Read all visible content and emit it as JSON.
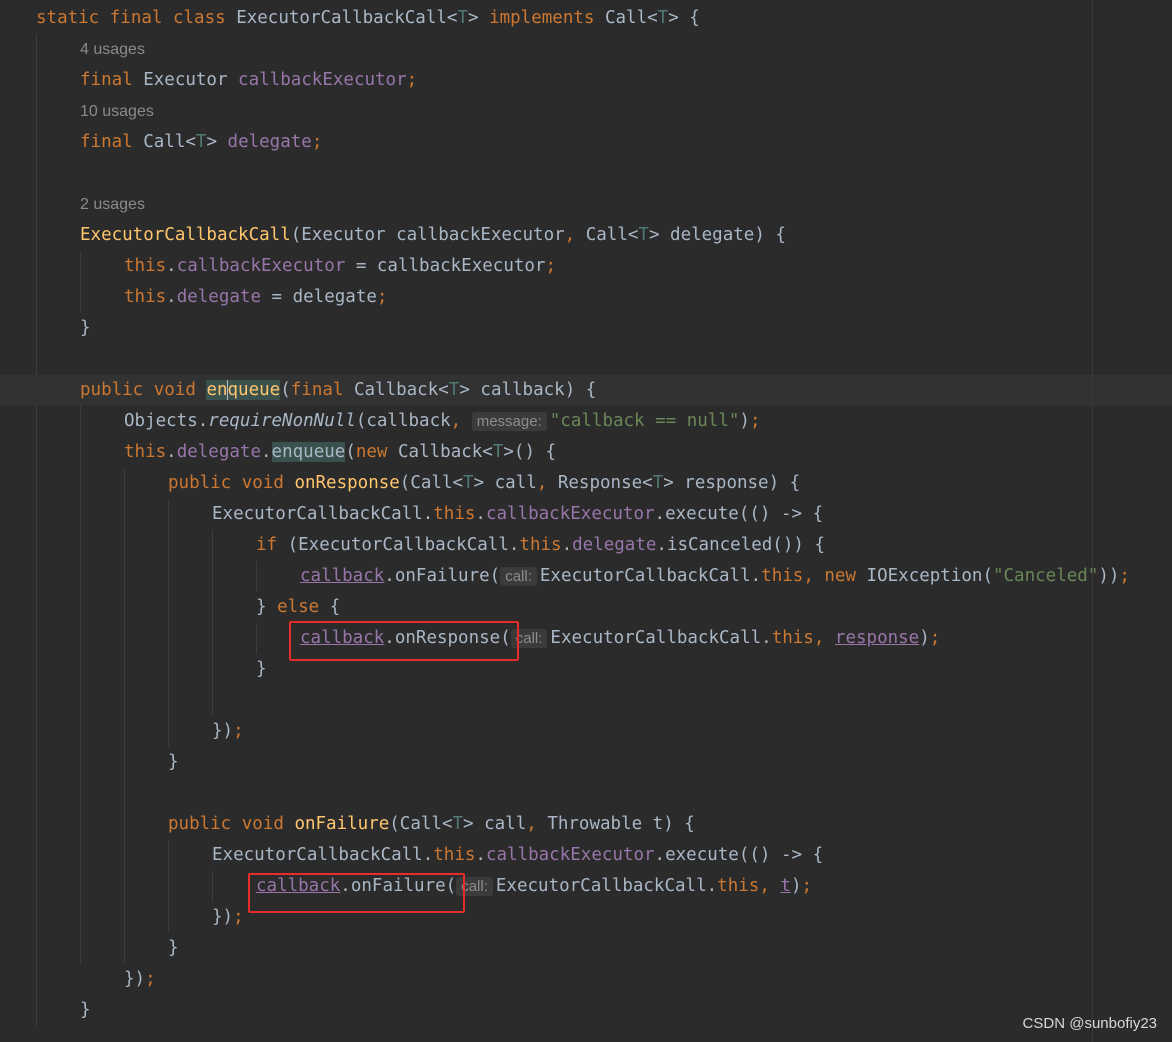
{
  "editor": {
    "lines": [
      {
        "tokens": [
          {
            "t": "static final class ",
            "c": "kw"
          },
          {
            "t": "ExecutorCallbackCall<"
          },
          {
            "t": "T",
            "c": "tp"
          },
          {
            "t": "> "
          },
          {
            "t": "implements ",
            "c": "kw"
          },
          {
            "t": "Call<"
          },
          {
            "t": "T",
            "c": "tp"
          },
          {
            "t": "> {"
          }
        ]
      },
      {
        "usage": "4 usages"
      },
      {
        "tokens": [
          {
            "t": "final ",
            "c": "kw"
          },
          {
            "t": "Executor "
          },
          {
            "t": "callbackExecutor",
            "c": "fld"
          },
          {
            "t": ";",
            "c": "kw"
          }
        ]
      },
      {
        "usage": "10 usages"
      },
      {
        "tokens": [
          {
            "t": "final ",
            "c": "kw"
          },
          {
            "t": "Call<"
          },
          {
            "t": "T",
            "c": "tp"
          },
          {
            "t": "> "
          },
          {
            "t": "delegate",
            "c": "fld"
          },
          {
            "t": ";",
            "c": "kw"
          }
        ]
      },
      {
        "tokens": []
      },
      {
        "usage": "2 usages"
      },
      {
        "tokens": [
          {
            "t": "ExecutorCallbackCall",
            "c": "fn"
          },
          {
            "t": "(Executor callbackExecutor"
          },
          {
            "t": ", ",
            "c": "kw"
          },
          {
            "t": "Call<"
          },
          {
            "t": "T",
            "c": "tp"
          },
          {
            "t": "> delegate) {"
          }
        ]
      },
      {
        "tokens": [
          {
            "t": "this",
            "c": "kw"
          },
          {
            "t": "."
          },
          {
            "t": "callbackExecutor",
            "c": "fld"
          },
          {
            "t": " = callbackExecutor"
          },
          {
            "t": ";",
            "c": "kw"
          }
        ]
      },
      {
        "tokens": [
          {
            "t": "this",
            "c": "kw"
          },
          {
            "t": "."
          },
          {
            "t": "delegate",
            "c": "fld"
          },
          {
            "t": " = delegate"
          },
          {
            "t": ";",
            "c": "kw"
          }
        ]
      },
      {
        "tokens": [
          {
            "t": "}"
          }
        ]
      },
      {
        "tokens": []
      },
      {
        "current": true,
        "tokens": [
          {
            "t": "public void ",
            "c": "kw"
          },
          {
            "t": "en",
            "c": "fn hl"
          },
          {
            "caret": true
          },
          {
            "t": "queue",
            "c": "fn hl"
          },
          {
            "t": "("
          },
          {
            "t": "final ",
            "c": "kw"
          },
          {
            "t": "Callback<"
          },
          {
            "t": "T",
            "c": "tp"
          },
          {
            "t": "> callback) {"
          }
        ]
      },
      {
        "tokens": [
          {
            "t": "Objects."
          },
          {
            "t": "requireNonNull",
            "c": "it"
          },
          {
            "t": "(callback"
          },
          {
            "t": ", ",
            "c": "kw"
          },
          {
            "hint": "message:"
          },
          {
            "t": "\"callback == null\"",
            "c": "str"
          },
          {
            "t": ")"
          },
          {
            "t": ";",
            "c": "kw"
          }
        ]
      },
      {
        "tokens": [
          {
            "t": "this",
            "c": "kw"
          },
          {
            "t": "."
          },
          {
            "t": "delegate",
            "c": "fld"
          },
          {
            "t": "."
          },
          {
            "t": "enqueue",
            "c": "hl"
          },
          {
            "t": "("
          },
          {
            "t": "new ",
            "c": "kw"
          },
          {
            "t": "Callback<"
          },
          {
            "t": "T",
            "c": "tp"
          },
          {
            "t": ">() {"
          }
        ]
      },
      {
        "tokens": [
          {
            "t": "public void ",
            "c": "kw"
          },
          {
            "t": "onResponse",
            "c": "fn"
          },
          {
            "t": "(Call<"
          },
          {
            "t": "T",
            "c": "tp"
          },
          {
            "t": "> call"
          },
          {
            "t": ", ",
            "c": "kw"
          },
          {
            "t": "Response<"
          },
          {
            "t": "T",
            "c": "tp"
          },
          {
            "t": "> response) {"
          }
        ]
      },
      {
        "tokens": [
          {
            "t": "ExecutorCallbackCall."
          },
          {
            "t": "this",
            "c": "kw"
          },
          {
            "t": "."
          },
          {
            "t": "callbackExecutor",
            "c": "fld"
          },
          {
            "t": ".execute(() -> {"
          }
        ]
      },
      {
        "tokens": [
          {
            "t": "if ",
            "c": "kw"
          },
          {
            "t": "(ExecutorCallbackCall."
          },
          {
            "t": "this",
            "c": "kw"
          },
          {
            "t": "."
          },
          {
            "t": "delegate",
            "c": "fld"
          },
          {
            "t": ".isCanceled()) {"
          }
        ]
      },
      {
        "tokens": [
          {
            "t": "callback",
            "c": "fld ul"
          },
          {
            "t": ".onFailure("
          },
          {
            "hint": "call:"
          },
          {
            "t": "ExecutorCallbackCall."
          },
          {
            "t": "this",
            "c": "kw"
          },
          {
            "t": ", ",
            "c": "kw"
          },
          {
            "t": "new ",
            "c": "kw"
          },
          {
            "t": "IOException("
          },
          {
            "t": "\"Canceled\"",
            "c": "str"
          },
          {
            "t": "))"
          },
          {
            "t": ";",
            "c": "kw"
          }
        ]
      },
      {
        "tokens": [
          {
            "t": "} "
          },
          {
            "t": "else ",
            "c": "kw"
          },
          {
            "t": "{"
          }
        ]
      },
      {
        "tokens": [
          {
            "t": "callback",
            "c": "fld ul"
          },
          {
            "t": ".onResponse("
          },
          {
            "hint": "call:"
          },
          {
            "t": "ExecutorCallbackCall."
          },
          {
            "t": "this",
            "c": "kw"
          },
          {
            "t": ", ",
            "c": "kw"
          },
          {
            "t": "response",
            "c": "fld ul"
          },
          {
            "t": ")"
          },
          {
            "t": ";",
            "c": "kw"
          }
        ]
      },
      {
        "tokens": [
          {
            "t": "}"
          }
        ]
      },
      {
        "tokens": []
      },
      {
        "tokens": [
          {
            "t": "})"
          },
          {
            "t": ";",
            "c": "kw"
          }
        ]
      },
      {
        "tokens": [
          {
            "t": "}"
          }
        ]
      },
      {
        "tokens": []
      },
      {
        "tokens": [
          {
            "t": "public void ",
            "c": "kw"
          },
          {
            "t": "onFailure",
            "c": "fn"
          },
          {
            "t": "(Call<"
          },
          {
            "t": "T",
            "c": "tp"
          },
          {
            "t": "> call"
          },
          {
            "t": ", ",
            "c": "kw"
          },
          {
            "t": "Throwable t) {"
          }
        ]
      },
      {
        "tokens": [
          {
            "t": "ExecutorCallbackCall."
          },
          {
            "t": "this",
            "c": "kw"
          },
          {
            "t": "."
          },
          {
            "t": "callbackExecutor",
            "c": "fld"
          },
          {
            "t": ".execute(() -> {"
          }
        ]
      },
      {
        "tokens": [
          {
            "t": "callback",
            "c": "fld ul"
          },
          {
            "t": ".onFailure("
          },
          {
            "hint": "call:"
          },
          {
            "t": "ExecutorCallbackCall."
          },
          {
            "t": "this",
            "c": "kw"
          },
          {
            "t": ", ",
            "c": "kw"
          },
          {
            "t": "t",
            "c": "fld ul"
          },
          {
            "t": ")"
          },
          {
            "t": ";",
            "c": "kw"
          }
        ]
      },
      {
        "tokens": [
          {
            "t": "})"
          },
          {
            "t": ";",
            "c": "kw"
          }
        ]
      },
      {
        "tokens": [
          {
            "t": "}"
          }
        ]
      },
      {
        "tokens": [
          {
            "t": "})"
          },
          {
            "t": ";",
            "c": "kw"
          }
        ]
      },
      {
        "tokens": [
          {
            "t": "}"
          }
        ]
      }
    ]
  },
  "colors": {
    "background": "#2b2b2b",
    "keyword": "#cc7832",
    "method_declaration": "#ffc66d",
    "field": "#9876aa",
    "string": "#6a8759",
    "type_parameter": "#507874",
    "default_text": "#a9b7c6",
    "annotation_box": "#e82c2c"
  },
  "watermark": "CSDN @sunbofiy23"
}
